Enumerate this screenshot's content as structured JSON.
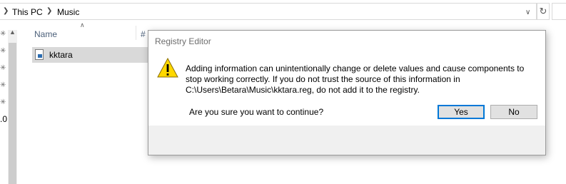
{
  "explorer": {
    "breadcrumb": [
      "This PC",
      "Music"
    ],
    "column_name": "Name",
    "column_hash": "#",
    "file_name": "kktara",
    "nav_fragment": ".0"
  },
  "dialog": {
    "title": "Registry Editor",
    "message": "Adding information can unintentionally change or delete values and cause components to stop working correctly. If you do not trust the source of this information in C:\\Users\\Betara\\Music\\kktara.reg, do not add it to the registry.",
    "question": "Are you sure you want to continue?",
    "yes_label": "Yes",
    "no_label": "No",
    "icon": "warning-icon"
  },
  "colors": {
    "accent": "#0078d7",
    "warning": "#ffd800"
  }
}
